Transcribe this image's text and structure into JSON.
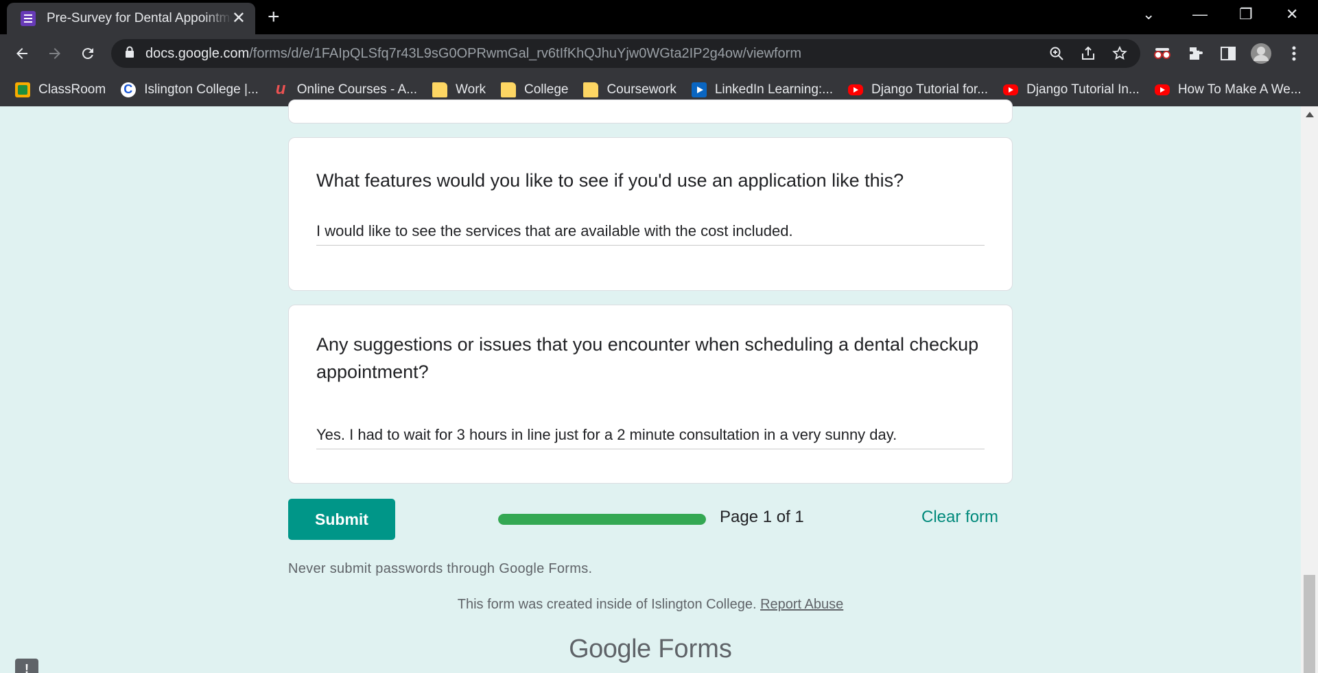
{
  "browser": {
    "tab_title": "Pre-Survey for Dental Appointment",
    "url_host": "docs.google.com",
    "url_path": "/forms/d/e/1FAIpQLSfq7r43L9sG0OPRwmGal_rv6tIfKhQJhuYjw0WGta2IP2g4ow/viewform",
    "bookmarks": [
      {
        "label": "ClassRoom",
        "icon": "classroom-icon"
      },
      {
        "label": "Islington College |...",
        "icon": "islington-icon"
      },
      {
        "label": "Online Courses - A...",
        "icon": "udemy-icon"
      },
      {
        "label": "Work",
        "icon": "folder-icon"
      },
      {
        "label": "College",
        "icon": "folder-icon"
      },
      {
        "label": "Coursework",
        "icon": "folder-icon"
      },
      {
        "label": "LinkedIn Learning:...",
        "icon": "linkedin-icon"
      },
      {
        "label": "Django Tutorial for...",
        "icon": "youtube-icon"
      },
      {
        "label": "Django Tutorial In...",
        "icon": "youtube-icon"
      },
      {
        "label": "How To Make A We...",
        "icon": "youtube-icon"
      }
    ]
  },
  "form": {
    "questions": [
      {
        "title": "What features would you like to see if you'd use an application like this?",
        "answer": "I would like to see the services that are available with the cost included."
      },
      {
        "title": "Any suggestions or issues that you encounter when scheduling a dental checkup appointment?",
        "answer": "Yes. I had to wait for 3 hours in line just for a 2 minute consultation in a very sunny day."
      }
    ],
    "submit_label": "Submit",
    "progress_fraction": 1.0,
    "page_label": "Page 1 of 1",
    "clear_label": "Clear form",
    "warning": "Never submit passwords through Google Forms.",
    "footer_text": "This form was created inside of Islington College.",
    "report_abuse_label": "Report Abuse",
    "brand_google": "Google",
    "brand_forms": "Forms",
    "report_badge": "!"
  },
  "colors": {
    "accent": "#009688",
    "progress": "#34a853",
    "background": "#e0f2f1"
  }
}
